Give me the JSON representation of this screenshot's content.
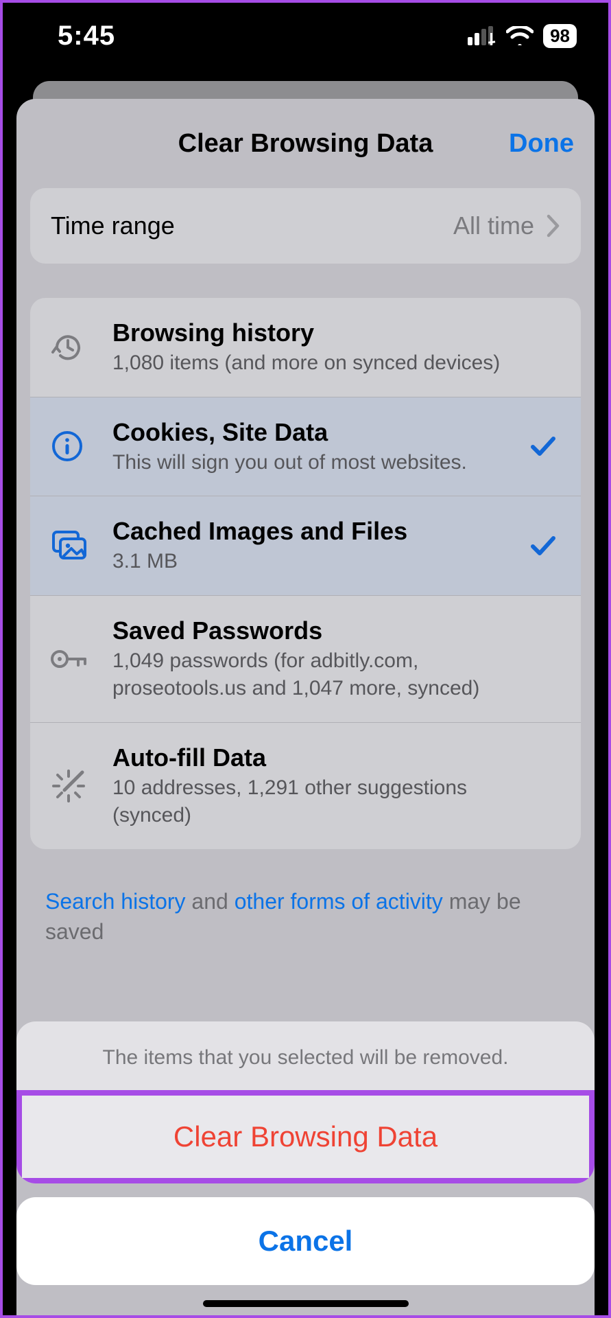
{
  "status_bar": {
    "time": "5:45",
    "battery": "98"
  },
  "sheet": {
    "title": "Clear Browsing Data",
    "done": "Done"
  },
  "time_range": {
    "label": "Time range",
    "value": "All time"
  },
  "items": [
    {
      "icon": "history-icon",
      "title": "Browsing history",
      "subtitle": "1,080 items (and more on synced devices)",
      "selected": false
    },
    {
      "icon": "info-icon",
      "title": "Cookies, Site Data",
      "subtitle": "This will sign you out of most websites.",
      "selected": true
    },
    {
      "icon": "images-icon",
      "title": "Cached Images and Files",
      "subtitle": "3.1 MB",
      "selected": true
    },
    {
      "icon": "key-icon",
      "title": "Saved Passwords",
      "subtitle": "1,049 passwords (for adbitly.com, proseotools.us and 1,047 more, synced)",
      "selected": false
    },
    {
      "icon": "wand-icon",
      "title": "Auto-fill Data",
      "subtitle": "10 addresses, 1,291 other suggestions (synced)",
      "selected": false
    }
  ],
  "footer": {
    "link1": "Search history",
    "mid": " and ",
    "link2": "other forms of activity",
    "tail": " may be saved"
  },
  "action_sheet": {
    "message": "The items that you selected will be removed.",
    "destructive": "Clear Browsing Data",
    "cancel": "Cancel"
  }
}
